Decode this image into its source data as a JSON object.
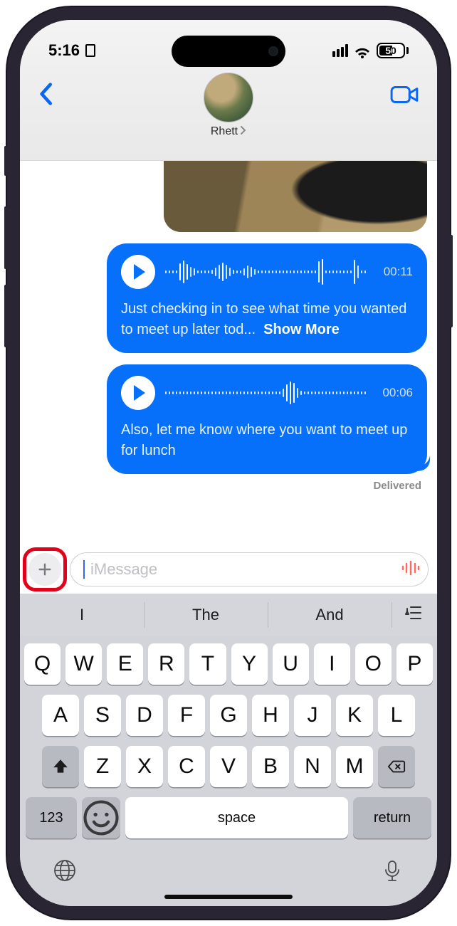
{
  "status": {
    "time": "5:16",
    "battery_pct": "50"
  },
  "header": {
    "contact_name": "Rhett"
  },
  "messages": {
    "m1": {
      "duration": "00:11",
      "transcript": "Just checking in to see what time you wanted to meet up later tod...",
      "show_more": "Show More"
    },
    "m2": {
      "duration": "00:06",
      "transcript": "Also, let me know where you want to meet up for lunch"
    }
  },
  "delivered": "Delivered",
  "input": {
    "placeholder": "iMessage"
  },
  "suggestions": {
    "s1": "I",
    "s2": "The",
    "s3": "And"
  },
  "keys": {
    "r1": [
      "Q",
      "W",
      "E",
      "R",
      "T",
      "Y",
      "U",
      "I",
      "O",
      "P"
    ],
    "r2": [
      "A",
      "S",
      "D",
      "F",
      "G",
      "H",
      "J",
      "K",
      "L"
    ],
    "r3": [
      "Z",
      "X",
      "C",
      "V",
      "B",
      "N",
      "M"
    ],
    "num": "123",
    "space": "space",
    "return": "return"
  }
}
